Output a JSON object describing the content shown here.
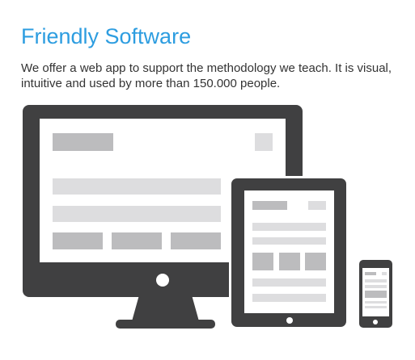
{
  "heading": {
    "title": "Friendly Software"
  },
  "intro": {
    "text": "We offer a web app to support the methodology we teach. It is visual, intuitive and used by more than 150.000 people."
  },
  "illustration": {
    "devices": [
      "desktop-monitor-icon",
      "tablet-icon",
      "smartphone-icon"
    ],
    "colors": {
      "frame": "#404041",
      "screen": "#ffffff",
      "block_dark": "#bcbcbe",
      "block_light": "#dddddf"
    }
  }
}
